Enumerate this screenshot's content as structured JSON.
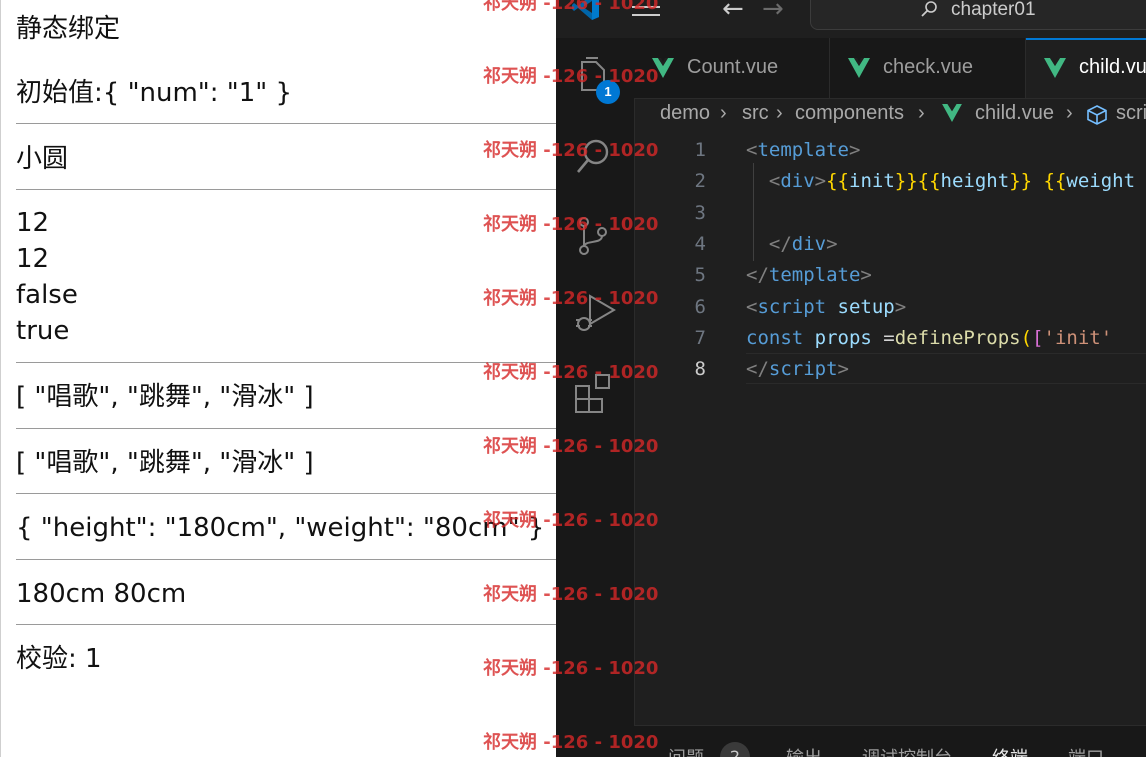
{
  "browser": {
    "title": "静态绑定",
    "initial": "初始值:{ \"num\": \"1\" }",
    "name": "小圆",
    "values": [
      "12",
      "12",
      "false",
      "true"
    ],
    "hobbies_1": "[ \"唱歌\", \"跳舞\", \"滑冰\" ]",
    "hobbies_2": "[ \"唱歌\", \"跳舞\", \"滑冰\" ]",
    "body_obj": "{ \"height\": \"180cm\", \"weight\": \"80cm\" }",
    "body_text": "180cm 80cm",
    "check": "校验: 1"
  },
  "editor": {
    "search_label": "chapter01",
    "tabs": [
      {
        "label": "Count.vue",
        "active": false
      },
      {
        "label": "check.vue",
        "active": false
      },
      {
        "label": "child.vue",
        "active": true
      }
    ],
    "breadcrumb": [
      "demo",
      "src",
      "components",
      "child.vue",
      "script setup"
    ],
    "badge_count": "1",
    "line_numbers": [
      "1",
      "2",
      "3",
      "4",
      "5",
      "6",
      "7",
      "8"
    ],
    "panel": {
      "problems": "问题",
      "problems_count": "2",
      "output": "输出",
      "debug_console": "调试控制台",
      "terminal": "终端",
      "ports": "端口"
    },
    "colors": {
      "background": "#1f1f1f",
      "accent": "#0078d4",
      "vue_green": "#41b883",
      "tag": "#569cd6",
      "brace": "#ffd700",
      "string": "#ce9178",
      "function": "#dcdcaa",
      "variable": "#9cdcfe"
    }
  },
  "code_lines": [
    [
      {
        "t": "<",
        "c": "punct"
      },
      {
        "t": "template",
        "c": "tag"
      },
      {
        "t": ">",
        "c": "punct"
      }
    ],
    [
      {
        "t": "  <",
        "c": "punct"
      },
      {
        "t": "div",
        "c": "tag"
      },
      {
        "t": ">",
        "c": "punct"
      },
      {
        "t": "{{",
        "c": "brace"
      },
      {
        "t": "init",
        "c": "var"
      },
      {
        "t": "}}",
        "c": "brace"
      },
      {
        "t": "{{",
        "c": "brace"
      },
      {
        "t": "height",
        "c": "var"
      },
      {
        "t": "}}",
        "c": "brace"
      },
      {
        "t": " ",
        "c": "plain"
      },
      {
        "t": "{{",
        "c": "brace"
      },
      {
        "t": "weight",
        "c": "var"
      }
    ],
    [],
    [
      {
        "t": "  </",
        "c": "punct"
      },
      {
        "t": "div",
        "c": "tag"
      },
      {
        "t": ">",
        "c": "punct"
      }
    ],
    [
      {
        "t": "</",
        "c": "punct"
      },
      {
        "t": "template",
        "c": "tag"
      },
      {
        "t": ">",
        "c": "punct"
      }
    ],
    [
      {
        "t": "<",
        "c": "punct"
      },
      {
        "t": "script",
        "c": "tag"
      },
      {
        "t": " ",
        "c": "plain"
      },
      {
        "t": "setup",
        "c": "var"
      },
      {
        "t": ">",
        "c": "punct"
      }
    ],
    [
      {
        "t": "const",
        "c": "kw"
      },
      {
        "t": " ",
        "c": "plain"
      },
      {
        "t": "props",
        "c": "var"
      },
      {
        "t": " =",
        "c": "plain"
      },
      {
        "t": "defineProps",
        "c": "fn"
      },
      {
        "t": "(",
        "c": "brace"
      },
      {
        "t": "[",
        "c": "bracket"
      },
      {
        "t": "'init'",
        "c": "str"
      }
    ],
    [
      {
        "t": "</",
        "c": "punct"
      },
      {
        "t": "script",
        "c": "tag"
      },
      {
        "t": ">",
        "c": "punct"
      }
    ]
  ],
  "watermark": "祁天朔 -126 - 1020"
}
